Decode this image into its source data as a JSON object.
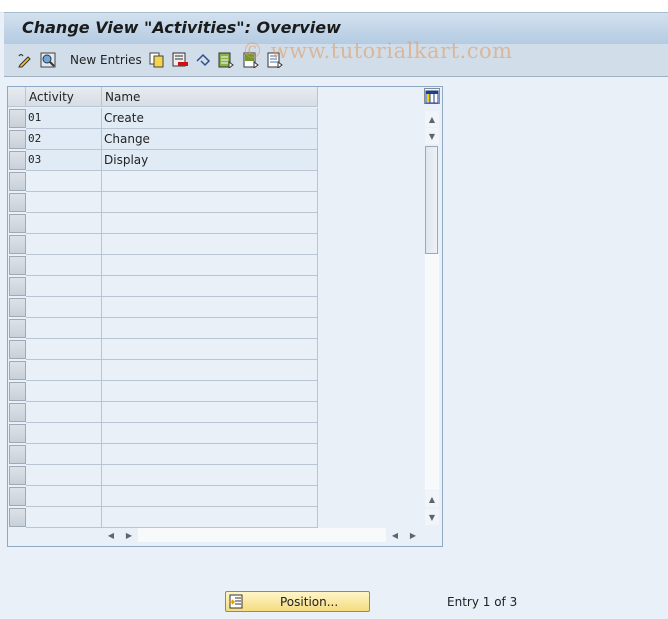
{
  "header": {
    "title": "Change View \"Activities\": Overview"
  },
  "toolbar": {
    "icons": [
      "display-change-icon",
      "find-icon",
      "copy-icon",
      "delete-icon",
      "undo-change-icon",
      "select-all-icon",
      "select-block-icon",
      "deselect-all-icon"
    ],
    "new_entries_label": "New Entries"
  },
  "watermark": "© www.tutorialkart.com",
  "table": {
    "columns": [
      "Activity",
      "Name"
    ],
    "rows": [
      {
        "activity": "01",
        "name": "Create"
      },
      {
        "activity": "02",
        "name": "Change"
      },
      {
        "activity": "03",
        "name": "Display"
      }
    ],
    "empty_rows": 17
  },
  "footer": {
    "position_label": "Position...",
    "entry_text": "Entry 1 of 3"
  }
}
